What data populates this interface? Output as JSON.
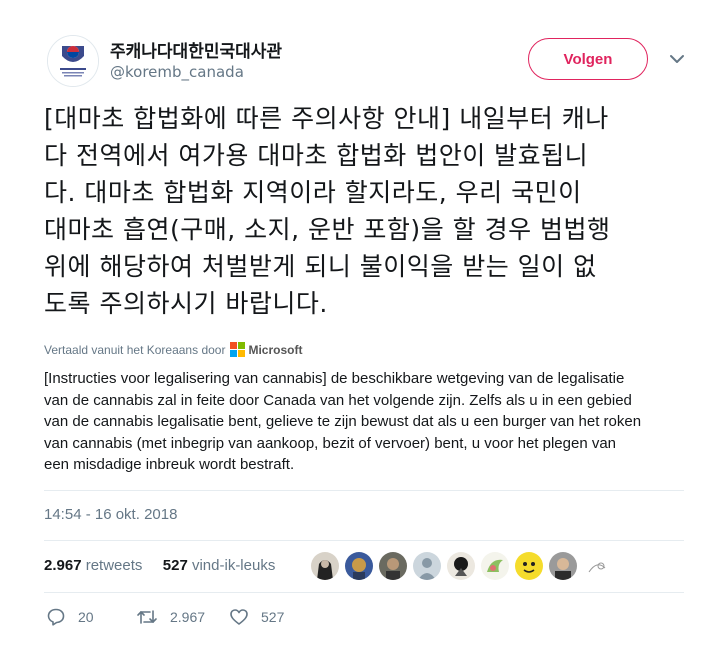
{
  "author": {
    "display_name": "주캐나다대한민국대사관",
    "handle": "@koremb_canada",
    "avatar_icon": "embassy-emblem-icon"
  },
  "follow_label": "Volgen",
  "tweet_lines": [
    "[대마초 합법화에 따른 주의사항 안내] 내일부터 캐나",
    "다 전역에서 여가용 대마초 합법화 법안이 발효됩니",
    "다. 대마초 합법화 지역이라 할지라도, 우리 국민이",
    "대마초 흡연(구매, 소지, 운반 포함)을 할 경우 범법행",
    "위에 해당하여 처벌받게 되니 불이익을 받는 일이 없",
    "도록 주의하시기 바랍니다."
  ],
  "translation": {
    "translated_by": "Vertaald vanuit het Koreaans door",
    "provider": "Microsoft",
    "lines": [
      "[Instructies voor legalisering van cannabis] de beschikbare wetgeving van de legalisatie",
      "van de cannabis zal in feite door Canada van het volgende zijn. Zelfs als u in een gebied",
      "van de cannabis legalisatie bent, gelieve te zijn bewust dat als u een burger van het roken",
      "van cannabis (met inbegrip van aankoop, bezit of vervoer) bent, u voor het plegen van",
      "een misdadige inbreuk wordt bestraft."
    ]
  },
  "timestamp": "14:54 - 16 okt. 2018",
  "stats": {
    "retweets_count": "2.967",
    "retweets_label": "retweets",
    "likes_count": "527",
    "likes_label": "vind-ik-leuks"
  },
  "actions": {
    "reply_count": "20",
    "retweet_count": "2.967",
    "like_count": "527"
  },
  "colors": {
    "follow_accent": "#e0245e",
    "secondary_text": "#657786",
    "divider": "#e6ecf0"
  }
}
